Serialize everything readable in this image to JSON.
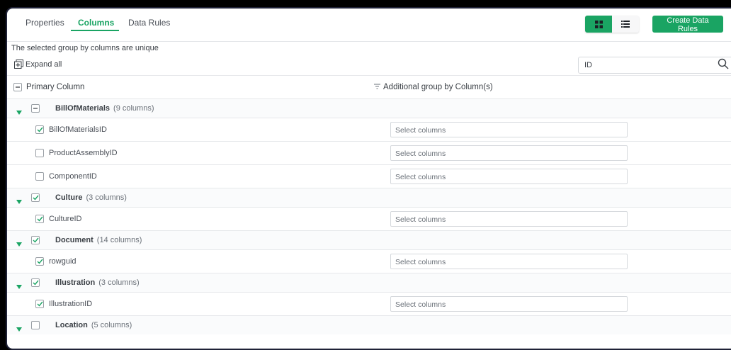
{
  "tabs": [
    "Properties",
    "Columns",
    "Data Rules"
  ],
  "active_tab": "Columns",
  "create_button": "Create Data Rules",
  "info_text": "The selected group by columns are unique",
  "expand_all": "Expand all",
  "search": {
    "value": "ID",
    "placeholder": ""
  },
  "columns": {
    "primary": "Primary Column",
    "additional": "Additional group by Column(s)"
  },
  "select_placeholder": "Select columns",
  "groups": [
    {
      "name": "BillOfMaterials",
      "count": "(9 columns)",
      "check": "partial",
      "items": [
        {
          "name": "BillOfMaterialsID",
          "checked": true
        },
        {
          "name": "ProductAssemblyID",
          "checked": false
        },
        {
          "name": "ComponentID",
          "checked": false
        }
      ]
    },
    {
      "name": "Culture",
      "count": "(3 columns)",
      "check": "checked",
      "items": [
        {
          "name": "CultureID",
          "checked": true
        }
      ]
    },
    {
      "name": "Document",
      "count": "(14 columns)",
      "check": "checked",
      "items": [
        {
          "name": "rowguid",
          "checked": true
        }
      ]
    },
    {
      "name": "Illustration",
      "count": "(3 columns)",
      "check": "checked",
      "items": [
        {
          "name": "IllustrationID",
          "checked": true
        }
      ]
    },
    {
      "name": "Location",
      "count": "(5 columns)",
      "check": "unchecked",
      "items": []
    }
  ],
  "colors": {
    "accent": "#1aa463",
    "text": "#3a3f45",
    "border": "#e6e8eb"
  }
}
